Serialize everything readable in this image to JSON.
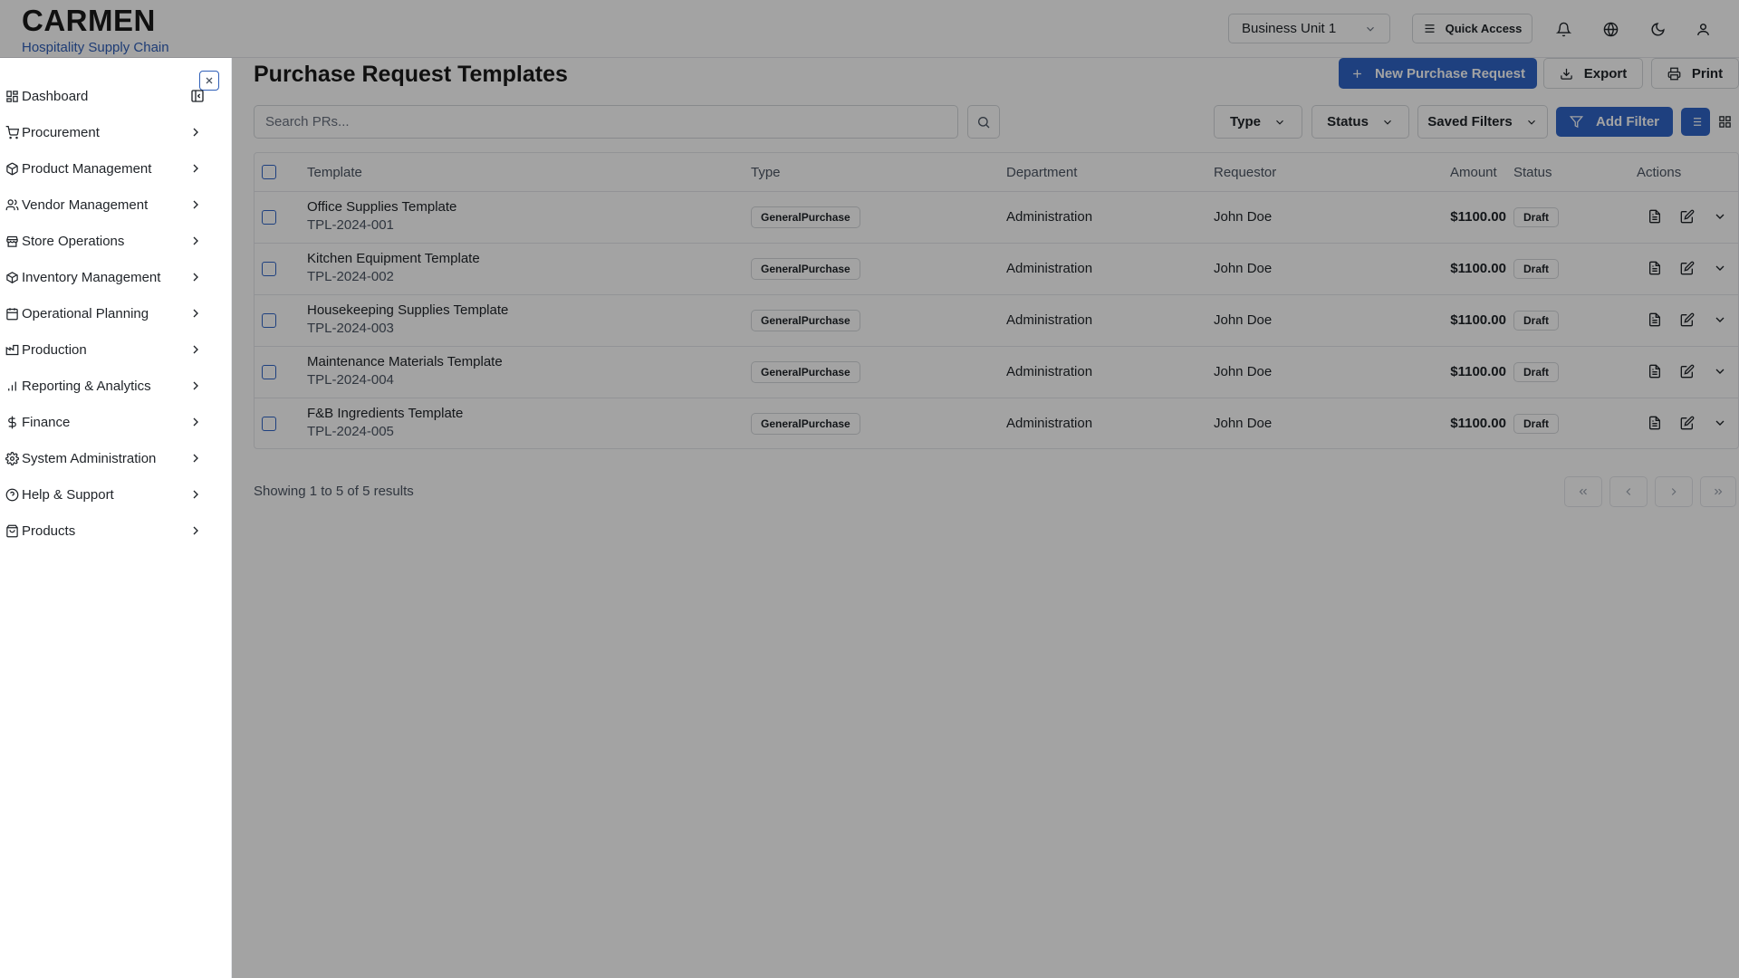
{
  "brand": {
    "title": "CARMEN",
    "subtitle": "Hospitality Supply Chain"
  },
  "topbar": {
    "business_unit": "Business Unit 1",
    "quick_access": "Quick Access"
  },
  "sidebar": {
    "items": [
      {
        "label": "Dashboard",
        "icon": "dashboard-icon"
      },
      {
        "label": "Procurement",
        "icon": "cart-icon"
      },
      {
        "label": "Product Management",
        "icon": "package-icon"
      },
      {
        "label": "Vendor Management",
        "icon": "users-icon"
      },
      {
        "label": "Store Operations",
        "icon": "store-icon"
      },
      {
        "label": "Inventory Management",
        "icon": "box-icon"
      },
      {
        "label": "Operational Planning",
        "icon": "calendar-icon"
      },
      {
        "label": "Production",
        "icon": "factory-icon"
      },
      {
        "label": "Reporting & Analytics",
        "icon": "bar-chart-icon"
      },
      {
        "label": "Finance",
        "icon": "dollar-icon"
      },
      {
        "label": "System Administration",
        "icon": "gear-icon"
      },
      {
        "label": "Help & Support",
        "icon": "help-icon"
      },
      {
        "label": "Products",
        "icon": "bag-icon"
      }
    ]
  },
  "main": {
    "title": "Purchase Request Templates",
    "new_button": "New Purchase Request",
    "export_button": "Export",
    "print_button": "Print",
    "search_placeholder": "Search PRs...",
    "filters": {
      "type": "Type",
      "status": "Status",
      "saved": "Saved Filters",
      "add": "Add Filter"
    }
  },
  "table": {
    "headers": {
      "template": "Template",
      "type": "Type",
      "department": "Department",
      "requestor": "Requestor",
      "amount": "Amount",
      "status": "Status",
      "actions": "Actions"
    },
    "rows": [
      {
        "name": "Office Supplies Template",
        "code": "TPL-2024-001",
        "type": "GeneralPurchase",
        "department": "Administration",
        "requestor": "John Doe",
        "amount": "$1100.00",
        "status": "Draft"
      },
      {
        "name": "Kitchen Equipment Template",
        "code": "TPL-2024-002",
        "type": "GeneralPurchase",
        "department": "Administration",
        "requestor": "John Doe",
        "amount": "$1100.00",
        "status": "Draft"
      },
      {
        "name": "Housekeeping Supplies Template",
        "code": "TPL-2024-003",
        "type": "GeneralPurchase",
        "department": "Administration",
        "requestor": "John Doe",
        "amount": "$1100.00",
        "status": "Draft"
      },
      {
        "name": "Maintenance Materials Template",
        "code": "TPL-2024-004",
        "type": "GeneralPurchase",
        "department": "Administration",
        "requestor": "John Doe",
        "amount": "$1100.00",
        "status": "Draft"
      },
      {
        "name": "F&B Ingredients Template",
        "code": "TPL-2024-005",
        "type": "GeneralPurchase",
        "department": "Administration",
        "requestor": "John Doe",
        "amount": "$1100.00",
        "status": "Draft"
      }
    ]
  },
  "pagination": {
    "summary": "Showing 1 to 5 of 5 results"
  },
  "colors": {
    "accent": "#2f65c7",
    "brand_sub": "#2f5fb8",
    "overlay": "rgba(0,0,0,0.36)"
  }
}
